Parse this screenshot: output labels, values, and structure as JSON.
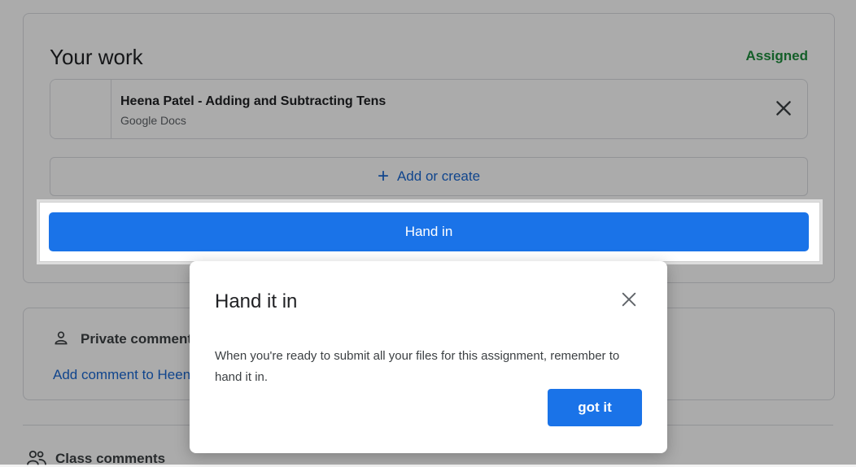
{
  "work": {
    "title": "Your work",
    "status": "Assigned",
    "attachment": {
      "title": "Heena Patel - Adding and Subtracting Tens",
      "subtitle": "Google Docs"
    },
    "add_label": "Add or create",
    "handin_label": "Hand in"
  },
  "private_comments": {
    "title": "Private comments",
    "add_link": "Add comment to Heena Patel"
  },
  "class_comments": {
    "title": "Class comments"
  },
  "dialog": {
    "title": "Hand it in",
    "body": "When you're ready to submit all your files for this assignment, remember to hand it in.",
    "ok_label": "got it"
  },
  "colors": {
    "primary": "#1a73e8",
    "assigned": "#1e8e3e",
    "link": "#1967d2"
  }
}
